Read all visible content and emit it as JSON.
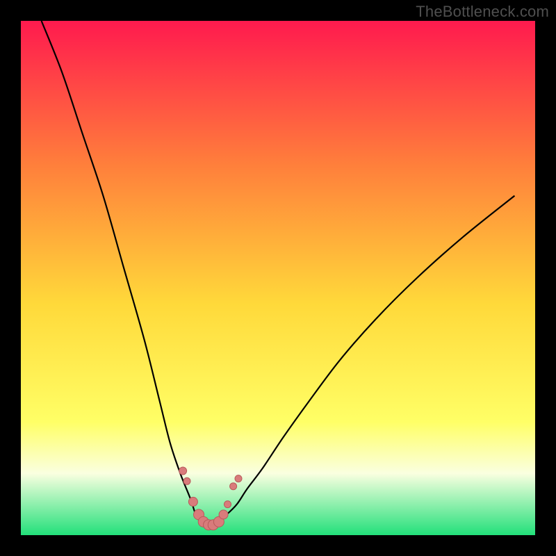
{
  "watermark": "TheBottleneck.com",
  "colors": {
    "gradient_top": "#ff1a4e",
    "gradient_mid_upper": "#ff7f3b",
    "gradient_mid": "#ffd93a",
    "gradient_mid_lower": "#ffff66",
    "gradient_green_band": "#faffe0",
    "gradient_bottom": "#22e07a",
    "frame": "#000000",
    "curve": "#000000",
    "marker_fill": "#d97b7b",
    "marker_stroke": "#b85a5a"
  },
  "chart_data": {
    "type": "line",
    "title": "",
    "xlabel": "",
    "ylabel": "",
    "xlim": [
      0,
      100
    ],
    "ylim": [
      0,
      100
    ],
    "series": [
      {
        "name": "bottleneck-curve",
        "x": [
          4,
          8,
          12,
          16,
          20,
          24,
          27,
          29,
          31,
          33,
          34,
          35,
          36,
          37,
          38,
          40,
          42,
          44,
          47,
          51,
          56,
          62,
          69,
          77,
          86,
          96
        ],
        "y": [
          100,
          90,
          78,
          66,
          52,
          38,
          26,
          18,
          12,
          7,
          4,
          2.5,
          2,
          2,
          2.5,
          4,
          6,
          9,
          13,
          19,
          26,
          34,
          42,
          50,
          58,
          66
        ]
      }
    ],
    "markers": {
      "name": "highlighted-points",
      "x": [
        31.5,
        32.3,
        33.5,
        34.6,
        35.5,
        36.5,
        37.4,
        38.5,
        39.4,
        40.2,
        41.3,
        42.3
      ],
      "y": [
        12.5,
        10.5,
        6.5,
        4.0,
        2.6,
        2.0,
        2.0,
        2.6,
        4.0,
        6.0,
        9.5,
        11.0
      ],
      "r": [
        5.5,
        5.0,
        6.5,
        7.5,
        7.5,
        7.5,
        7.5,
        7.5,
        6.5,
        5.0,
        5.0,
        5.0
      ]
    }
  }
}
